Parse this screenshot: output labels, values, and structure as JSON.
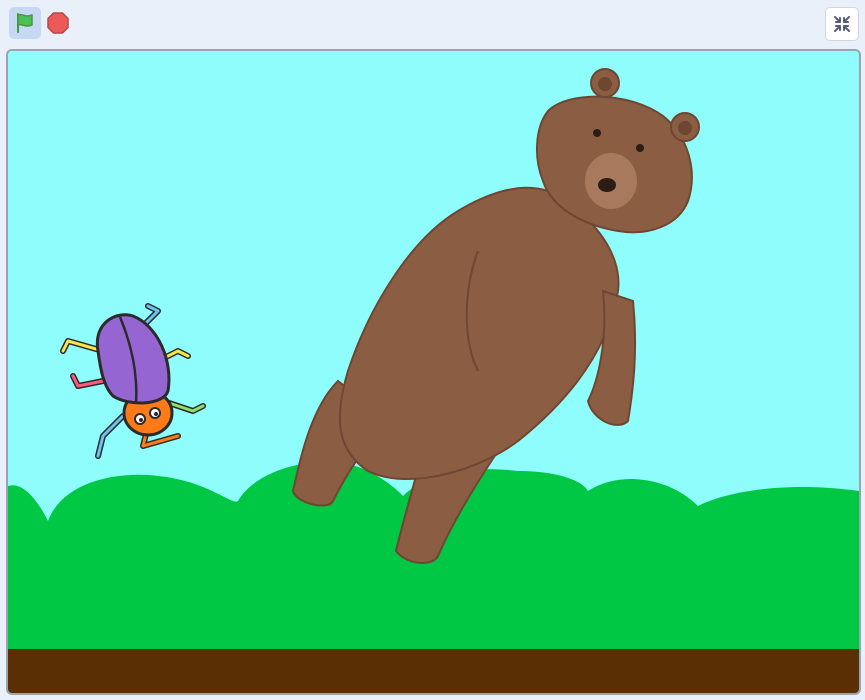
{
  "toolbar": {
    "green_flag": {
      "icon": "green-flag-icon",
      "color": "#4cbf56"
    },
    "stop": {
      "icon": "stop-sign-icon",
      "color": "#ec5959"
    },
    "fullscreen": {
      "icon": "exit-fullscreen-icon"
    }
  },
  "stage": {
    "backdrop": {
      "sky_color": "#8ffdfc",
      "grass_color": "#00c844",
      "dirt_color": "#5a2f04"
    },
    "sprites": [
      {
        "name": "Beetle",
        "colors": {
          "shell": "#9566d2",
          "head": "#ff7a18"
        }
      },
      {
        "name": "Bear",
        "colors": {
          "fur": "#8b5e44",
          "fur_dark": "#6e4631"
        }
      }
    ]
  }
}
